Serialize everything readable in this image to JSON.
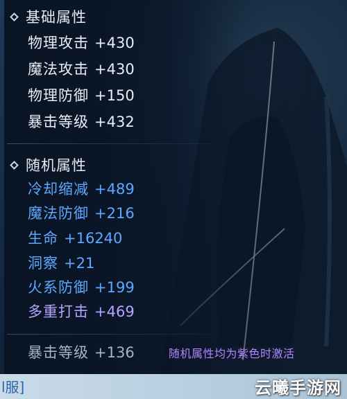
{
  "base_section": {
    "title": "基础属性",
    "stats": [
      {
        "name": "物理攻击",
        "value": "+430"
      },
      {
        "name": "魔法攻击",
        "value": "+430"
      },
      {
        "name": "物理防御",
        "value": "+150"
      },
      {
        "name": "暴击等级",
        "value": "+432"
      }
    ]
  },
  "random_section": {
    "title": "随机属性",
    "stats": [
      {
        "name": "冷却缩减",
        "value": "+489",
        "color": "blue"
      },
      {
        "name": "魔法防御",
        "value": "+216",
        "color": "blue"
      },
      {
        "name": "生命",
        "value": "+16240",
        "color": "blue"
      },
      {
        "name": "洞察",
        "value": "+21",
        "color": "blue"
      },
      {
        "name": "火系防御",
        "value": "+199",
        "color": "blue"
      },
      {
        "name": "多重打击",
        "value": "+469",
        "color": "purple"
      }
    ]
  },
  "extra_stat": {
    "name": "暴击等级",
    "value": "+136"
  },
  "note": "随机属性均为紫色时激活",
  "bottom_text": "l服]",
  "watermark": "云曦手游网",
  "colors": {
    "white": "#e9eef5",
    "blue": "#5ea8ff",
    "purple": "#b7a6ff",
    "note_purple": "#b186ff"
  }
}
